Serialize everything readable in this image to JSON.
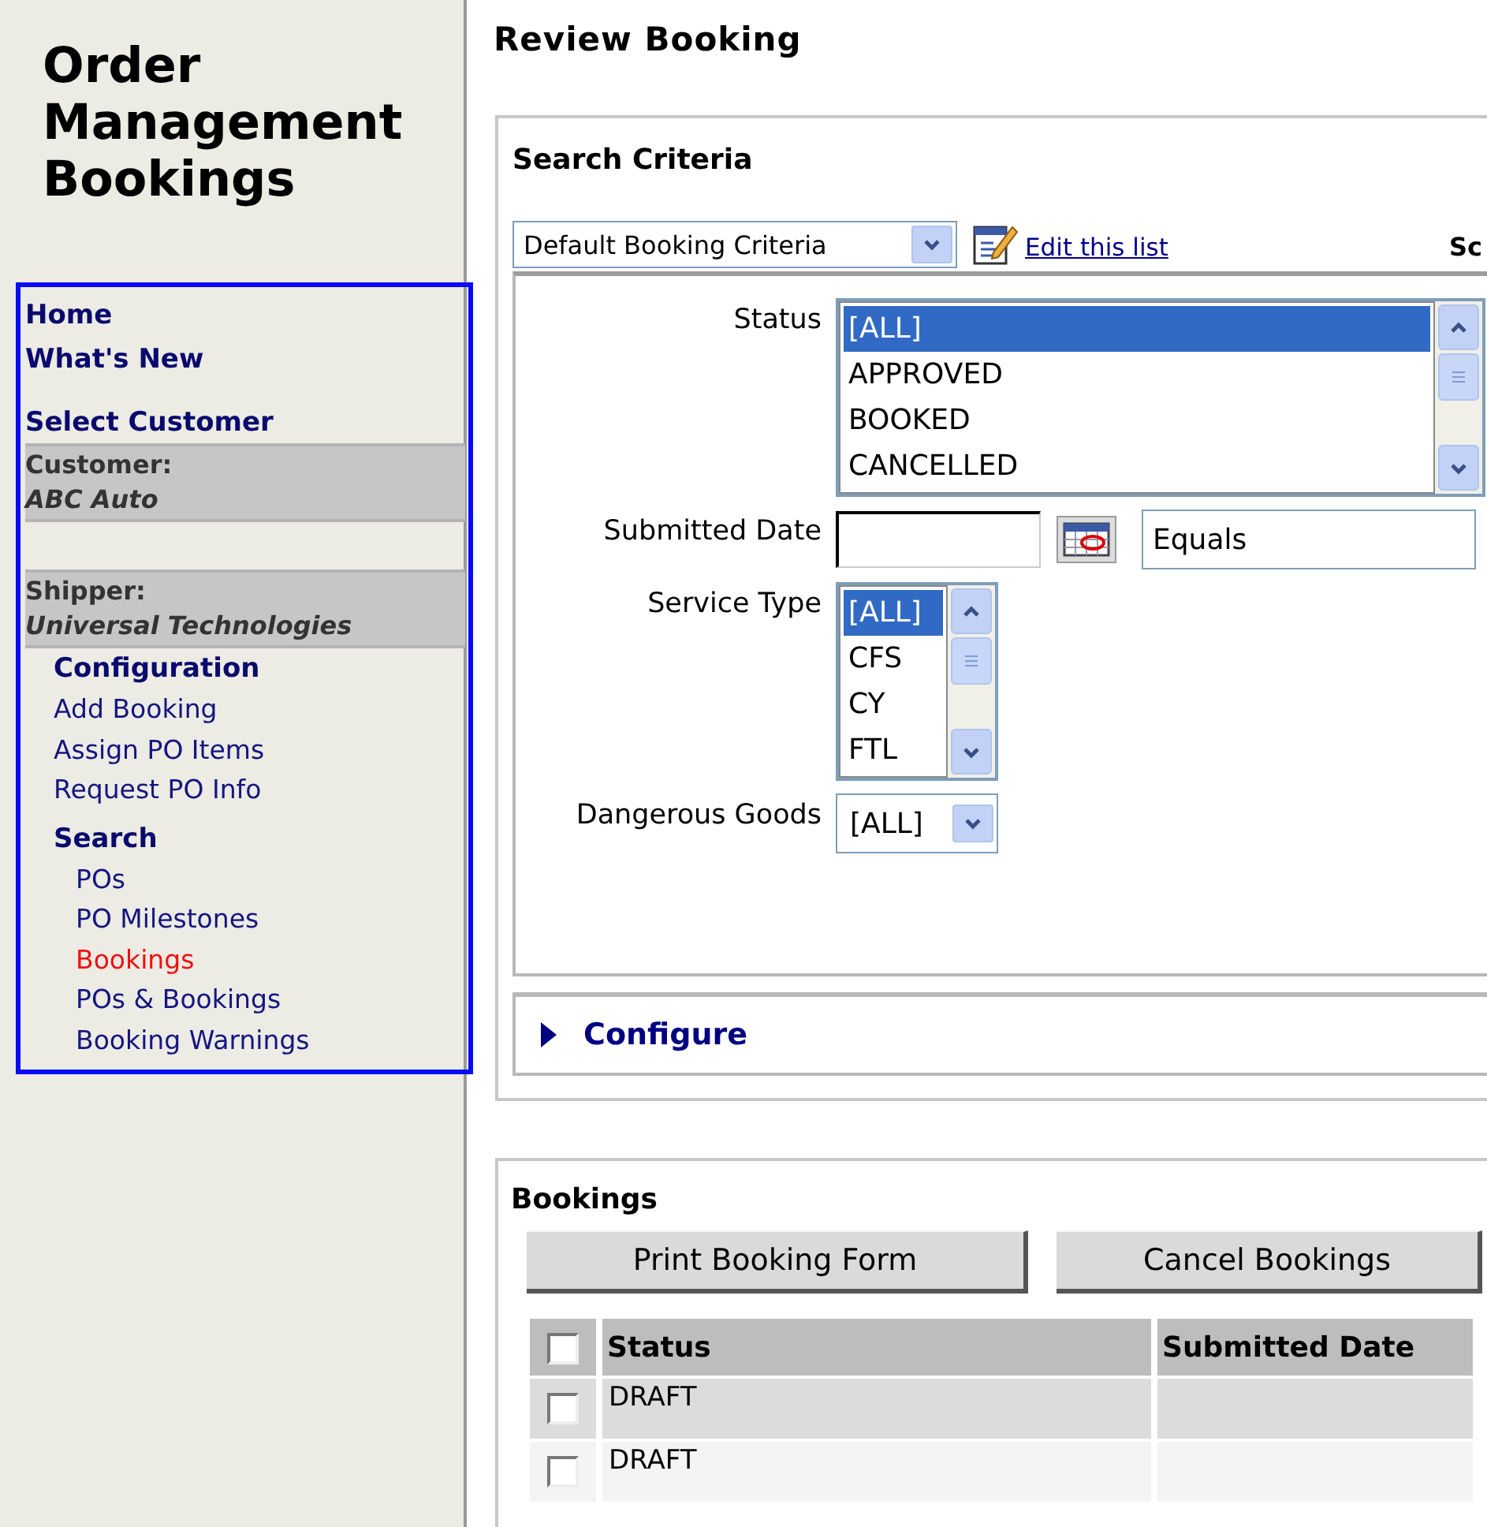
{
  "sidebar": {
    "title": "Order Management Bookings",
    "links": [
      {
        "label": "Home",
        "selected": false
      },
      {
        "label": "What's New",
        "selected": false
      },
      {
        "label": "Select Customer",
        "selected": false
      }
    ],
    "context": [
      {
        "label": "Customer:",
        "value": "ABC Auto"
      },
      {
        "label": "Shipper:",
        "value": "Universal Technologies"
      }
    ],
    "menu": [
      {
        "kind": "heading",
        "label": "Configuration"
      },
      {
        "kind": "link",
        "label": "Add Booking",
        "selected": false
      },
      {
        "kind": "link",
        "label": "Assign PO Items",
        "selected": false
      },
      {
        "kind": "link",
        "label": "Request PO Info",
        "selected": false
      },
      {
        "kind": "heading",
        "label": "Search",
        "children": [
          {
            "label": "POs",
            "selected": false
          },
          {
            "label": "PO Milestones",
            "selected": false
          },
          {
            "label": "Bookings",
            "selected": true
          },
          {
            "label": "POs & Bookings",
            "selected": false
          },
          {
            "label": "Booking Warnings",
            "selected": false
          }
        ]
      }
    ]
  },
  "page_title": "Review Booking",
  "search_criteria": {
    "title": "Search Criteria",
    "preset": "Default Booking Criteria",
    "edit_link": "Edit this list",
    "cut_label": "Sc",
    "fields": [
      {
        "kind": "wide_list",
        "label": "Status",
        "options": [
          {
            "text": "[ALL]",
            "selected": true
          },
          {
            "text": "APPROVED",
            "selected": false
          },
          {
            "text": "BOOKED",
            "selected": false
          },
          {
            "text": "CANCELLED",
            "selected": false
          }
        ]
      },
      {
        "kind": "date",
        "label": "Submitted Date",
        "operator": "Equals"
      },
      {
        "kind": "list",
        "label": "Service Type",
        "options": [
          {
            "text": "[ALL]",
            "selected": true
          },
          {
            "text": "CFS",
            "selected": false
          },
          {
            "text": "CY",
            "selected": false
          },
          {
            "text": "FTL",
            "selected": false
          }
        ]
      },
      {
        "kind": "select",
        "label": "Dangerous Goods",
        "value": "[ALL]"
      }
    ],
    "configure": {
      "label": "Configure",
      "expanded": false
    }
  },
  "bookings": {
    "title": "Bookings",
    "buttons": [
      "Print Booking Form",
      "Cancel Bookings"
    ],
    "select_all": {
      "checked": false
    },
    "columns": [
      "Status",
      "Submitted Date"
    ],
    "rows": [
      {
        "checked": false,
        "status": "DRAFT"
      },
      {
        "checked": false,
        "status": "DRAFT"
      }
    ]
  }
}
